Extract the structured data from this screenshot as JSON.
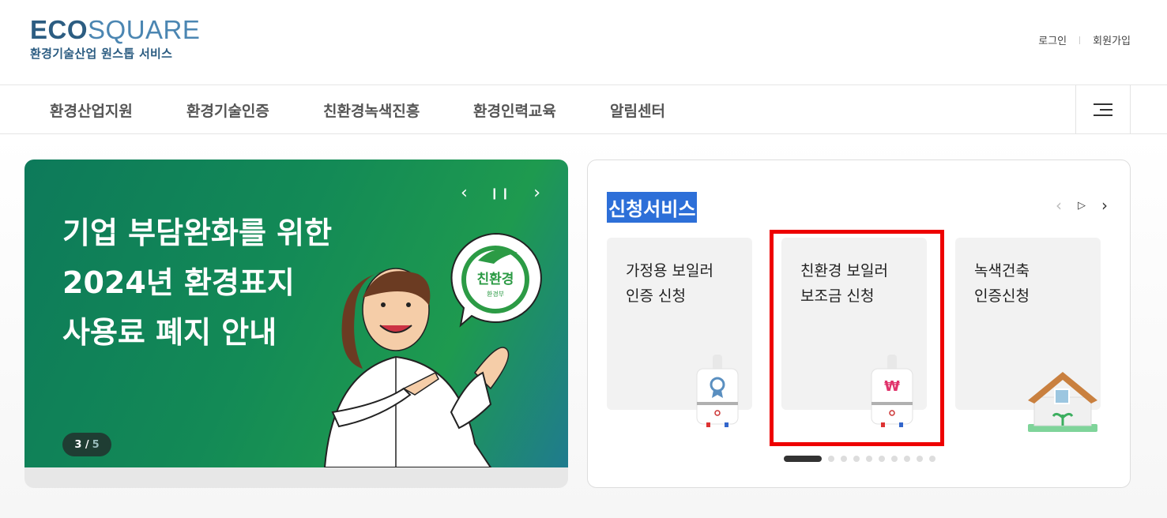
{
  "logo": {
    "brand_bold": "ECO",
    "brand_light": "SQUARE",
    "tagline": "환경기술산업 원스톱 서비스"
  },
  "util_links": [
    "로그인",
    "회원가입"
  ],
  "gnb": [
    "환경산업지원",
    "환경기술인증",
    "친환경녹색진흥",
    "환경인력교육",
    "알림센터"
  ],
  "banner": {
    "title_lines": [
      "기업 부담완화를 위한",
      "2024년 환경표지",
      "사용료 폐지 안내"
    ],
    "counter_current": "3 /",
    "counter_total": "5",
    "badge_text": "친환경",
    "badge_sub": "환경부"
  },
  "services": {
    "title": "신청서비스",
    "cards": [
      {
        "lines": [
          "가정용 보일러",
          "인증 신청"
        ],
        "icon": "boiler-medal-icon"
      },
      {
        "lines": [
          "친환경 보일러",
          "보조금 신청"
        ],
        "icon": "boiler-won-icon"
      },
      {
        "lines": [
          "녹색건축",
          "인증신청"
        ],
        "icon": "green-house-icon"
      }
    ],
    "icon_glyph_won": "₩",
    "pager_total": 10,
    "pager_active": 1
  },
  "colors": {
    "brand": "#2c5d82",
    "banner_green": "#138a56",
    "highlight": "#ee0000",
    "selection": "#2d6fd8"
  }
}
